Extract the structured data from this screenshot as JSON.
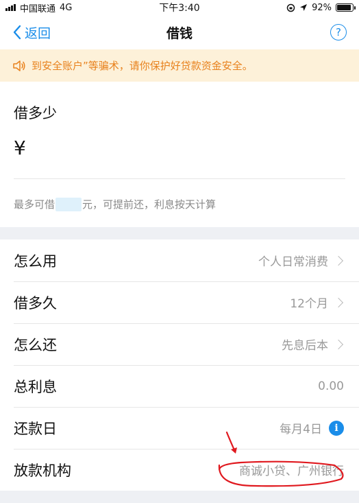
{
  "status_bar": {
    "carrier": "中国联通",
    "network": "4G",
    "time": "下午3:40",
    "battery": "92%",
    "battery_level": 0.92
  },
  "nav": {
    "back_label": "返回",
    "title": "借钱",
    "help_icon": "question-circle-icon"
  },
  "notice": {
    "icon": "speaker-icon",
    "text": "到安全账户”等骗术，请你保护好贷款资金安全。"
  },
  "amount": {
    "label": "借多少",
    "currency": "¥",
    "hint_prefix": "最多可借",
    "hint_suffix": "元，可提前还，利息按天计算"
  },
  "rows": [
    {
      "label": "怎么用",
      "value": "个人日常消费"
    },
    {
      "label": "借多久",
      "value": "12个月"
    },
    {
      "label": "怎么还",
      "value": "先息后本"
    },
    {
      "label": "总利息",
      "value": "0.00"
    },
    {
      "label": "还款日",
      "value": "每月4日"
    },
    {
      "label": "放款机构",
      "value": "商诚小贷、广州银行"
    }
  ],
  "colors": {
    "accent": "#1a8de9",
    "notice_text": "#e8811c",
    "notice_bg": "#fdf1d9",
    "annotation": "#e0191f"
  }
}
